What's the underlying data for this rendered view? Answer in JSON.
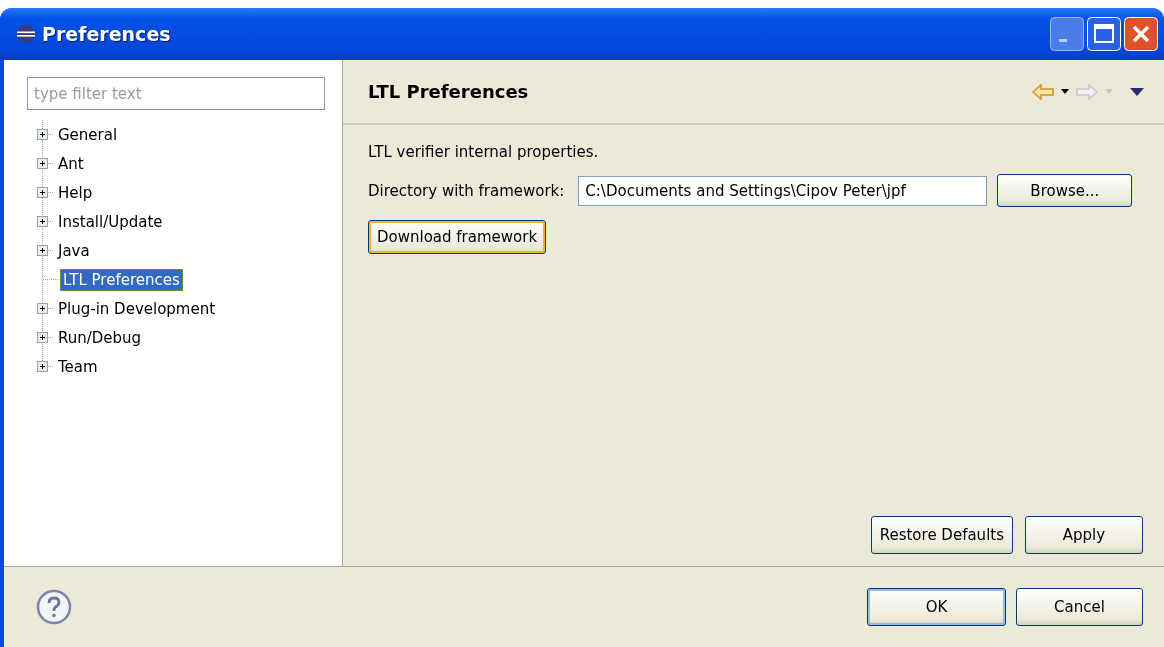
{
  "window": {
    "title": "Preferences"
  },
  "filter": {
    "placeholder": "type filter text"
  },
  "tree": [
    {
      "label": "General",
      "kind": "collapsed",
      "selected": false
    },
    {
      "label": "Ant",
      "kind": "collapsed",
      "selected": false
    },
    {
      "label": "Help",
      "kind": "collapsed",
      "selected": false
    },
    {
      "label": "Install/Update",
      "kind": "collapsed",
      "selected": false
    },
    {
      "label": "Java",
      "kind": "collapsed",
      "selected": false
    },
    {
      "label": "LTL Preferences",
      "kind": "leaf",
      "selected": true
    },
    {
      "label": "Plug-in Development",
      "kind": "collapsed",
      "selected": false
    },
    {
      "label": "Run/Debug",
      "kind": "collapsed",
      "selected": false
    },
    {
      "label": "Team",
      "kind": "collapsed",
      "selected": false
    }
  ],
  "page": {
    "title": "LTL Preferences",
    "description": "LTL verifier internal properties.",
    "directory_label": "Directory with framework:",
    "directory_value": "C:\\Documents and Settings\\Cipov Peter\\jpf",
    "browse_button": "Browse...",
    "download_button": "Download framework",
    "restore_button": "Restore Defaults",
    "apply_button": "Apply"
  },
  "buttons": [
    {
      "label": "OK",
      "default": true
    },
    {
      "label": "Cancel",
      "default": false
    }
  ]
}
